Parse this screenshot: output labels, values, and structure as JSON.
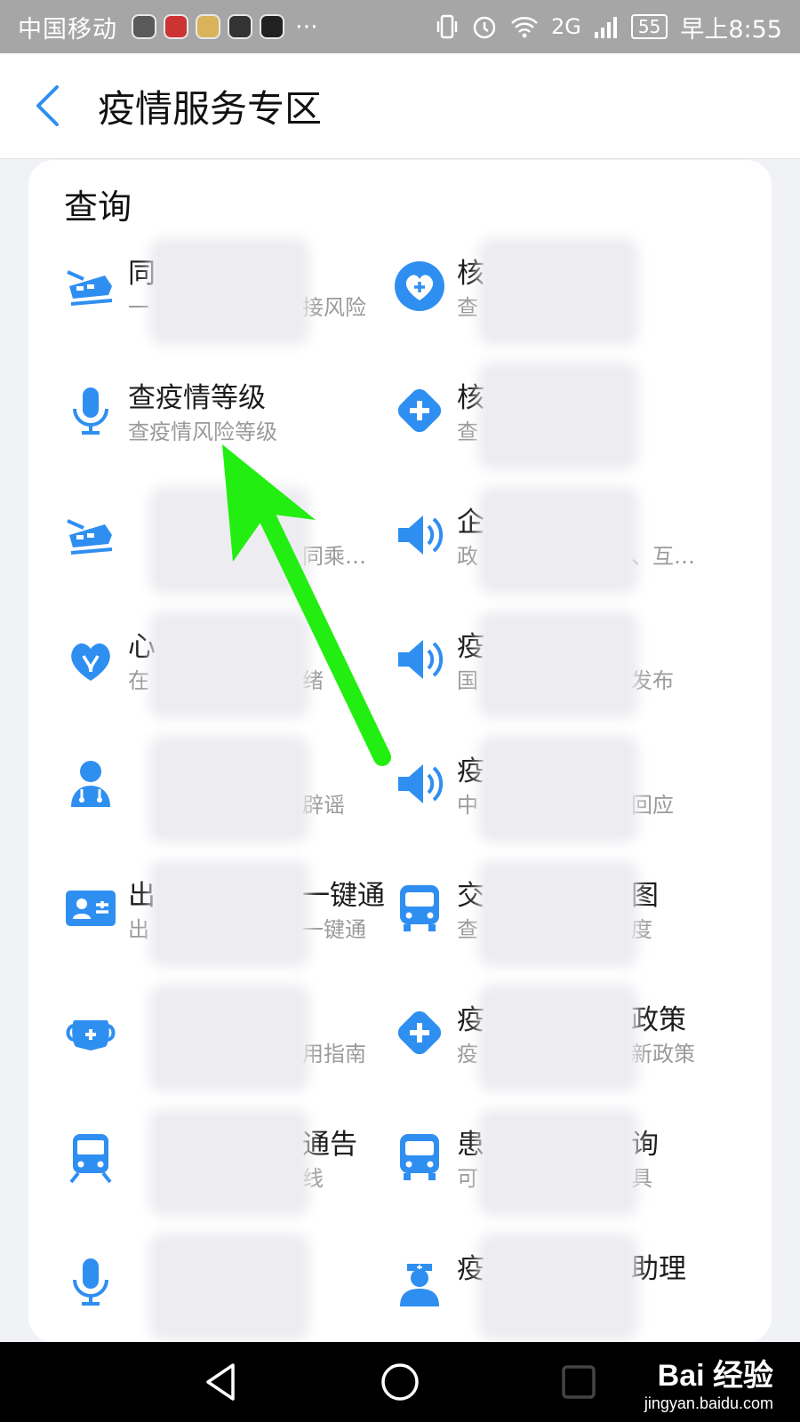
{
  "status_bar": {
    "carrier": "中国移动",
    "dots": "···",
    "network": "2G",
    "battery": "55",
    "time": "早上8:55"
  },
  "header": {
    "title": "疫情服务专区"
  },
  "section": {
    "title": "查询"
  },
  "items": [
    {
      "title": "同",
      "subtitle": "一",
      "subtitle_tail": "接风险",
      "icon": "train-icon"
    },
    {
      "title": "核",
      "subtitle": "查",
      "icon": "heart-plus-icon"
    },
    {
      "title": "查疫情等级",
      "subtitle": "查疫情风险等级",
      "icon": "microphone-icon"
    },
    {
      "title": "核",
      "subtitle": "查",
      "icon": "medical-cross-icon"
    },
    {
      "title": "",
      "subtitle": "",
      "subtitle_tail": "同乘…",
      "icon": "train-icon"
    },
    {
      "title": "企",
      "subtitle": "政",
      "subtitle_tail": "、互…",
      "icon": "speaker-icon"
    },
    {
      "title": "心",
      "subtitle": "在",
      "subtitle_tail": "绪",
      "icon": "heart-hands-icon"
    },
    {
      "title": "疫",
      "subtitle": "国",
      "subtitle_tail": "发布",
      "icon": "speaker-icon"
    },
    {
      "title": "",
      "subtitle": "",
      "subtitle_tail": "辟谣",
      "icon": "doctor-icon"
    },
    {
      "title": "疫",
      "subtitle": "中",
      "subtitle_tail": "回应",
      "icon": "speaker-icon"
    },
    {
      "title": "出",
      "title_tail": "一键通",
      "subtitle": "出",
      "subtitle_tail": "一键通",
      "icon": "id-card-icon"
    },
    {
      "title": "交",
      "title_tail": "图",
      "subtitle": "查",
      "subtitle_tail": "度",
      "icon": "bus-icon"
    },
    {
      "title": "",
      "subtitle": "",
      "subtitle_tail": "用指南",
      "icon": "mask-icon"
    },
    {
      "title": "疫",
      "title_tail": "政策",
      "subtitle": "疫",
      "subtitle_tail": "新政策",
      "icon": "medical-cross-icon"
    },
    {
      "title": "",
      "title_tail": "通告",
      "subtitle": "",
      "subtitle_tail": "线",
      "icon": "metro-icon"
    },
    {
      "title": "患",
      "title_tail": "询",
      "subtitle": "可",
      "subtitle_tail": "具",
      "icon": "bus-icon"
    },
    {
      "title": "",
      "subtitle": "",
      "icon": "microphone-icon"
    },
    {
      "title": "疫",
      "title_tail": "助理",
      "subtitle": "",
      "icon": "nurse-icon"
    }
  ],
  "watermark": {
    "line1": "Bai 经验",
    "line2": "jingyan.baidu.com"
  },
  "colors": {
    "accent": "#2f8ff1",
    "arrow": "#22ee11"
  }
}
